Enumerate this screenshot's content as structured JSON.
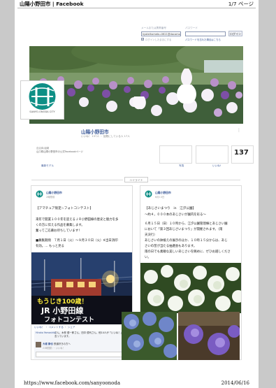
{
  "header": {
    "title": "山陽小野田市 | Facebook",
    "page_indicator": "1/7 ページ"
  },
  "login": {
    "email_label": "メールまたは携帯番号",
    "email_value": "kyoteihomebu.0611@docomo",
    "password_label": "パスワード",
    "login_button": "ログイン",
    "keep_logged_in": "ログインしたままにする",
    "forgot_password": "パスワードを忘れた場合はこちら"
  },
  "profile": {
    "logo_caption": "SANYO-ONODA CITY",
    "name": "山陽小野田市",
    "subline": "いいね！ 137人 ・ 話題にしている人 17人",
    "about_label": "自治体/組織",
    "about_text": "山口県山陽小野田市の公式Facebookページ",
    "likes_count": "137"
  },
  "tabs": {
    "timeline": "最新モデル",
    "photos": "写真",
    "likes": "いいね!"
  },
  "highlight_button": "ハイライト",
  "post1": {
    "page_name": "山陽小野田市",
    "date": "2時間前",
    "title": "【アマチュア限定☆フォトコンテスト】",
    "lines": [
      "来年で開業１００年を迎えるＪＲ小野田線の歴史と魅力を多",
      "くの方に伝える作品を募集します。",
      "奮ってご応募お待ちしています！",
      "",
      "■募集期間　７月１日（火）～９月３０日（火）※当日消印",
      "有効。… もっと見る"
    ],
    "image_text": {
      "line1": "もうじき100歳！",
      "line2": "JR 小野田線",
      "line3": "フォトコンテスト"
    },
    "actions": "いいね！ ・ コメントする ・ シェア",
    "comment_author": "Hiroko Yamashita",
    "comment_text": "さん、木林 優一郎さん、田中 優代さん、他14人が「いいね！」と言っています。",
    "comment2_author": "大城 静也",
    "comment2_text": "鉄道好きの方へ",
    "comment2_time": "21時間前 ・ いいね！"
  },
  "post2": {
    "page_name": "山陽小野田市",
    "date": "6月13日",
    "title": "【あじさいまつり　in　江汐公園】",
    "lines": [
      "～約４，０００本のあじさいが園内を彩る～",
      "",
      "６月１５日（日）１０時から、江汐公園管理棟とあじさい園",
      "において「第３回あじさいまつり」が開催されます。（雨",
      "天決行）",
      "あじさいの鉢植えの展示のほか、１０時１５分からは、あじ",
      "さいの苗が当たる抽選会もあります。",
      "雨の日でも素敵な美しいあじさいを眺めに、ぜひお越しくださ",
      "い。"
    ]
  },
  "footer": {
    "url": "https://www.facebook.com/sanyoonoda",
    "date": "2014/06/16"
  }
}
